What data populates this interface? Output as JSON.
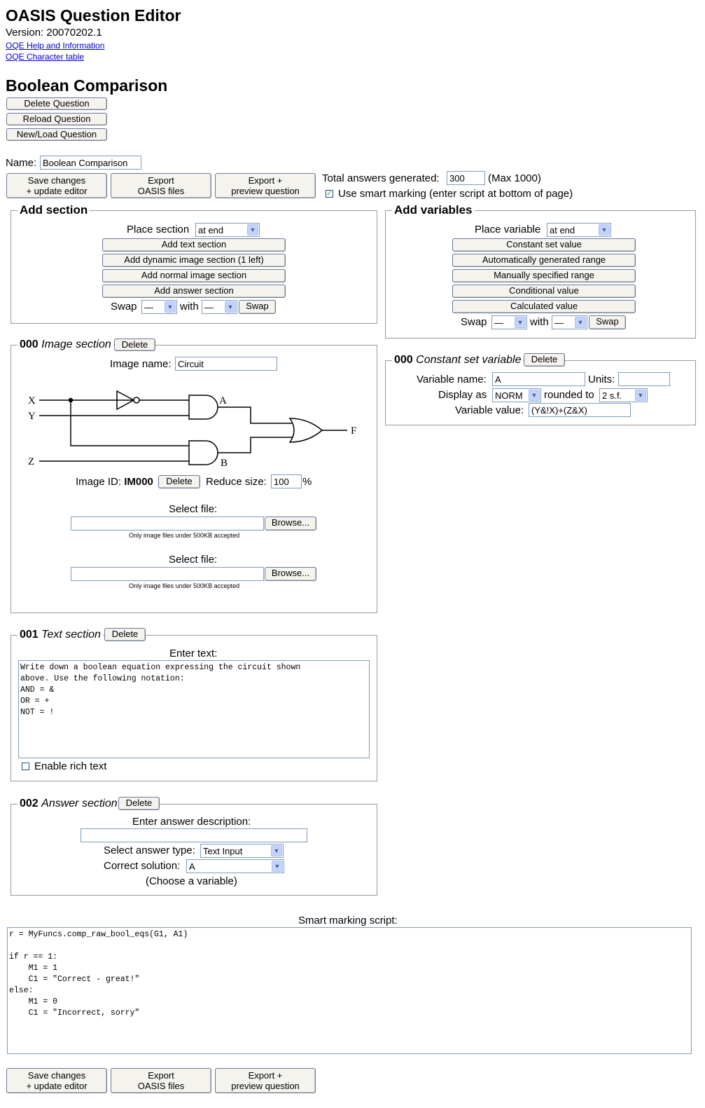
{
  "header": {
    "title": "OASIS Question Editor",
    "version": "Version: 20070202.1",
    "help_link": "OQE Help and Information",
    "char_link": "OQE Character table"
  },
  "question": {
    "title": "Boolean Comparison",
    "delete_button": "Delete Question",
    "reload_button": "Reload Question",
    "newload_button": "New/Load Question",
    "name_label": "Name:",
    "name_value": "Boolean Comparison"
  },
  "toolbar": {
    "save_line1": "Save changes",
    "save_line2": "+ update editor",
    "export_line1": "Export",
    "export_line2": "OASIS files",
    "preview_line1": "Export +",
    "preview_line2": "preview question",
    "total_label": "Total answers generated:",
    "total_value": "300",
    "total_max": "(Max 1000)",
    "smart_label": "Use smart marking (enter script at bottom of page)"
  },
  "add_section": {
    "legend": "Add section",
    "place_label": "Place section",
    "place_value": "at end",
    "buttons": [
      "Add text section",
      "Add dynamic image section (1 left)",
      "Add normal image section",
      "Add answer section"
    ],
    "swap_label": "Swap",
    "with_label": "with",
    "swap_from": "—",
    "swap_to": "—",
    "swap_button": "Swap"
  },
  "add_variables": {
    "legend": "Add variables",
    "place_label": "Place variable",
    "place_value": "at end",
    "buttons": [
      "Constant set value",
      "Automatically generated range",
      "Manually specified range",
      "Conditional value",
      "Calculated value"
    ],
    "swap_label": "Swap",
    "with_label": "with",
    "swap_from": "—",
    "swap_to": "—",
    "swap_button": "Swap"
  },
  "image_section": {
    "number": "000",
    "type": "Image section",
    "delete": "Delete",
    "image_name_label": "Image name:",
    "image_name_value": "Circuit",
    "circuit_labels": {
      "x": "X",
      "y": "Y",
      "z": "Z",
      "a": "A",
      "b": "B",
      "f": "F"
    },
    "image_id_label": "Image ID:",
    "image_id_value": "IM000",
    "image_delete": "Delete",
    "reduce_label": "Reduce size:",
    "reduce_value": "100",
    "reduce_unit": "%",
    "select_file_label": "Select file:",
    "browse": "Browse...",
    "file_note": "Only image files under 500KB accepted"
  },
  "variable": {
    "number": "000",
    "type": "Constant set variable",
    "delete": "Delete",
    "name_label": "Variable name:",
    "name_value": "A",
    "units_label": "Units:",
    "units_value": "",
    "display_label": "Display as",
    "display_value": "NORM",
    "rounded_label": "rounded to",
    "rounded_value": "2 s.f.",
    "value_label": "Variable value:",
    "value_value": "(Y&!X)+(Z&X)"
  },
  "text_section": {
    "number": "001",
    "type": "Text section",
    "delete": "Delete",
    "enter_label": "Enter text:",
    "text": "Write down a boolean equation expressing the circuit shown\nabove. Use the following notation:\nAND = &\nOR = +\nNOT = !",
    "rich_label": "Enable rich text"
  },
  "answer_section": {
    "number": "002",
    "type": "Answer section",
    "delete": "Delete",
    "desc_label": "Enter answer description:",
    "desc_value": "",
    "type_label": "Select answer type:",
    "type_value": "Text Input",
    "correct_label": "Correct solution:",
    "correct_value": "A",
    "choose_note": "(Choose a variable)"
  },
  "smart_marking": {
    "label": "Smart marking script:",
    "script": "r = MyFuncs.comp_raw_bool_eqs(G1, A1)\n\nif r == 1:\n    M1 = 1\n    C1 = \"Correct - great!\"\nelse:\n    M1 = 0\n    C1 = \"Incorrect, sorry\""
  }
}
